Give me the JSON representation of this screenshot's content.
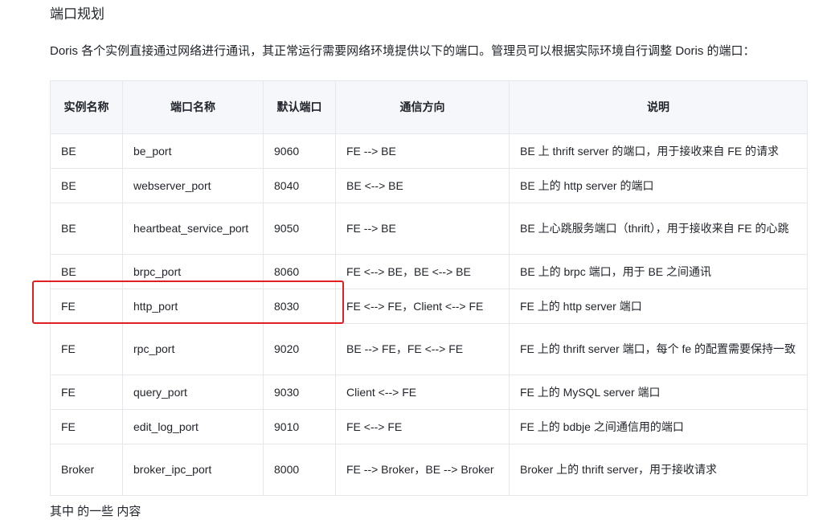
{
  "section": {
    "title": "端口规划",
    "intro": "Doris 各个实例直接通过网络进行通讯，其正常运行需要网络环境提供以下的端口。管理员可以根据实际环境自行调整 Doris 的端口："
  },
  "table": {
    "headers": {
      "instance": "实例名称",
      "port_name": "端口名称",
      "default_port": "默认端口",
      "direction": "通信方向",
      "description": "说明"
    },
    "rows": [
      {
        "instance": "BE",
        "port_name": "be_port",
        "default_port": "9060",
        "direction": "FE --> BE",
        "description": "BE 上 thrift server 的端口，用于接收来自 FE 的请求"
      },
      {
        "instance": "BE",
        "port_name": "webserver_port",
        "default_port": "8040",
        "direction": "BE <--> BE",
        "description": "BE 上的 http server 的端口"
      },
      {
        "instance": "BE",
        "port_name": "heartbeat_service_port",
        "default_port": "9050",
        "direction": "FE --> BE",
        "description": "BE 上心跳服务端口（thrift），用于接收来自 FE 的心跳"
      },
      {
        "instance": "BE",
        "port_name": "brpc_port",
        "default_port": "8060",
        "direction": "FE <--> BE，BE <--> BE",
        "description": "BE 上的 brpc 端口，用于 BE 之间通讯"
      },
      {
        "instance": "FE",
        "port_name": "http_port",
        "default_port": "8030",
        "direction": "FE <--> FE，Client <--> FE",
        "description": "FE 上的 http server 端口"
      },
      {
        "instance": "FE",
        "port_name": "rpc_port",
        "default_port": "9020",
        "direction": "BE --> FE，FE <--> FE",
        "description": "FE 上的 thrift server 端口，每个 fe 的配置需要保持一致"
      },
      {
        "instance": "FE",
        "port_name": "query_port",
        "default_port": "9030",
        "direction": "Client <--> FE",
        "description": "FE 上的 MySQL server 端口"
      },
      {
        "instance": "FE",
        "port_name": "edit_log_port",
        "default_port": "9010",
        "direction": "FE <--> FE",
        "description": "FE 上的 bdbje 之间通信用的端口"
      },
      {
        "instance": "Broker",
        "port_name": "broker_ipc_port",
        "default_port": "8000",
        "direction": "FE --> Broker，BE --> Broker",
        "description": "Broker 上的 thrift server，用于接收请求"
      }
    ]
  },
  "annotation": {
    "highlight_color": "#e02020"
  },
  "footer": {
    "cut_text": "其中 的一些 内容"
  }
}
